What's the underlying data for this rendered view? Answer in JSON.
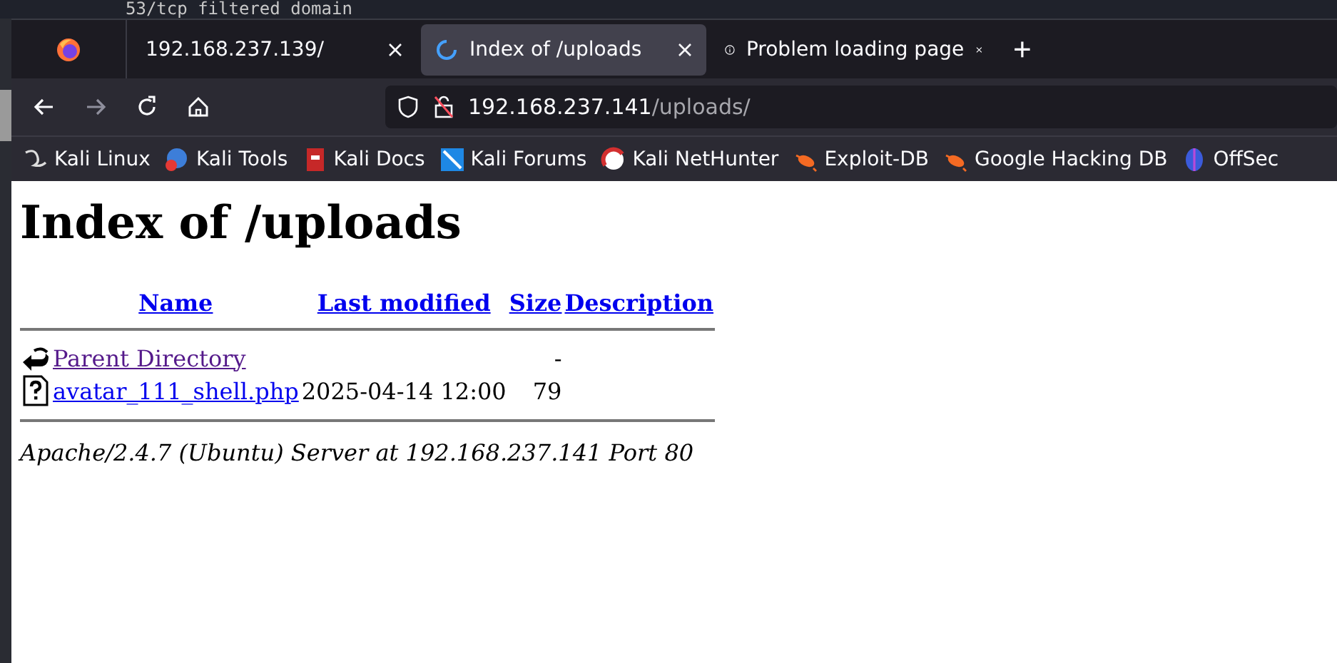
{
  "background_terminal": {
    "line": "53/tcp filtered domain"
  },
  "tabs": [
    {
      "title": "192.168.237.139/",
      "kind": "plain",
      "selected": false
    },
    {
      "title": "Index of /uploads",
      "kind": "loading",
      "selected": true
    },
    {
      "title": "Problem loading page",
      "kind": "error",
      "selected": false
    }
  ],
  "new_tab": "+",
  "address_bar": {
    "host": "192.168.237.141",
    "path": "/uploads/"
  },
  "bookmarks": [
    {
      "label": "Kali Linux"
    },
    {
      "label": "Kali Tools"
    },
    {
      "label": "Kali Docs"
    },
    {
      "label": "Kali Forums"
    },
    {
      "label": "Kali NetHunter"
    },
    {
      "label": "Exploit-DB"
    },
    {
      "label": "Google Hacking DB"
    },
    {
      "label": "OffSec"
    }
  ],
  "page": {
    "heading": "Index of /uploads",
    "columns": [
      "Name",
      "Last modified",
      "Size",
      "Description"
    ],
    "rows": [
      {
        "kind": "parent",
        "name": "Parent Directory",
        "visited": true,
        "modified": "",
        "size": "-"
      },
      {
        "kind": "file",
        "name": "avatar_111_shell.php",
        "visited": false,
        "modified": "2025-04-14 12:00",
        "size": "79"
      }
    ],
    "footer": "Apache/2.4.7 (Ubuntu) Server at 192.168.237.141 Port 80"
  }
}
